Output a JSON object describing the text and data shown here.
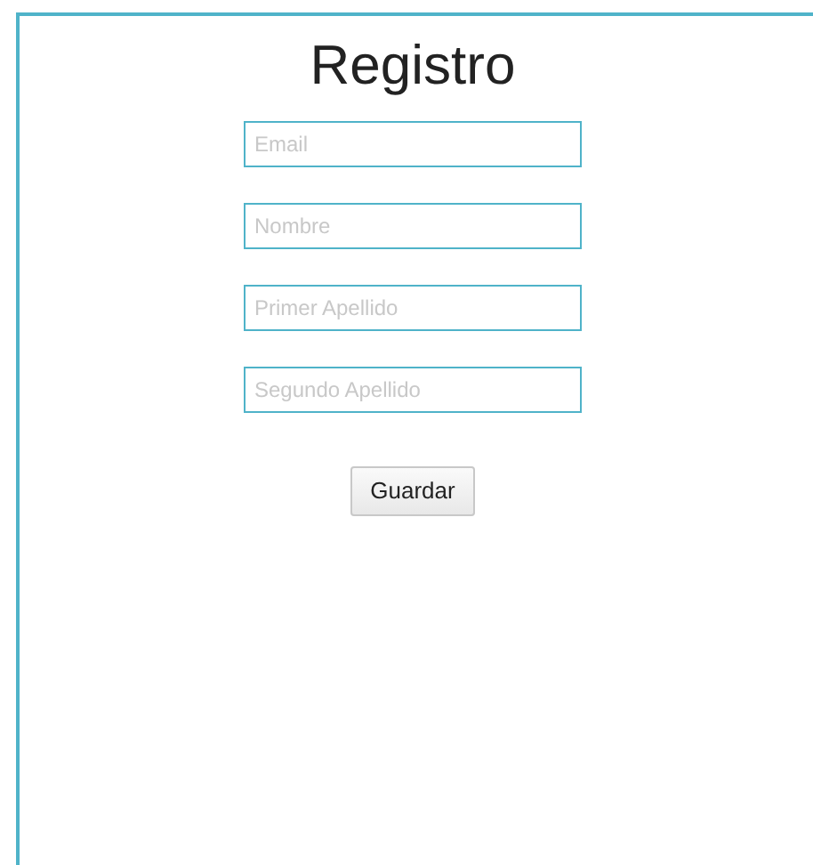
{
  "title": "Registro",
  "fields": [
    {
      "placeholder": "Email"
    },
    {
      "placeholder": "Nombre"
    },
    {
      "placeholder": "Primer Apellido"
    },
    {
      "placeholder": "Segundo Apellido"
    }
  ],
  "button": "Guardar"
}
